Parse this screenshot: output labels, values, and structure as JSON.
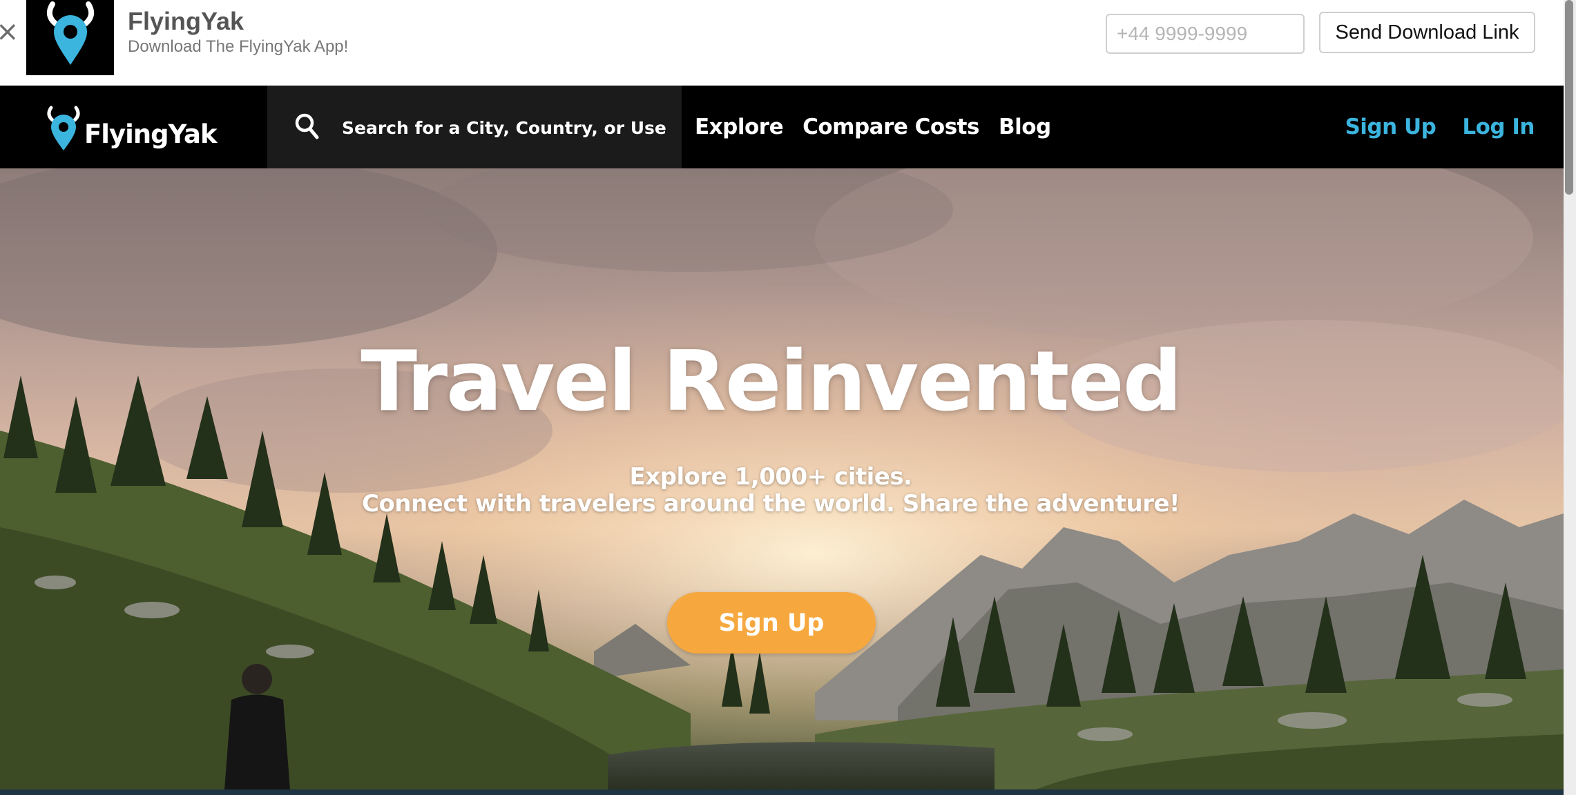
{
  "app_banner": {
    "close_glyph": "×",
    "app_name": "FlyingYak",
    "tagline": "Download The FlyingYak App!",
    "phone_placeholder": "+44 9999-9999",
    "send_button": "Send Download Link",
    "icon": "yak-pin-icon"
  },
  "navbar": {
    "logo_text": "FlyingYak",
    "search_placeholder": "Search for a City, Country, or User",
    "links": [
      "Explore",
      "Compare Costs",
      "Blog"
    ],
    "signup": "Sign Up",
    "login": "Log In"
  },
  "hero": {
    "title": "Travel Reinvented",
    "line1": "Explore 1,000+ cities.",
    "line2": "Connect with travelers around the world. Share the adventure!",
    "cta": "Sign Up"
  },
  "colors": {
    "brand_blue": "#3bb4de",
    "cta_orange": "#f6a83f",
    "nav_bg": "#000000",
    "search_bg": "#1b1b1b"
  }
}
